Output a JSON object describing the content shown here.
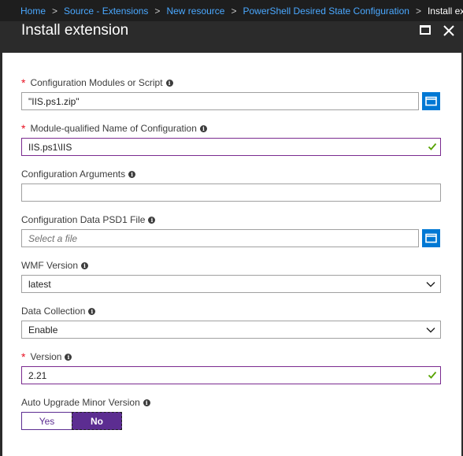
{
  "breadcrumb": {
    "items": [
      "Home",
      "Source - Extensions",
      "New resource",
      "PowerShell Desired State Configuration"
    ],
    "current": "Install extension",
    "separator": ">"
  },
  "header": {
    "title": "Install extension"
  },
  "fields": {
    "config_modules": {
      "label": "Configuration Modules or Script",
      "required": true,
      "value": "\"IIS.ps1.zip\""
    },
    "module_name": {
      "label": "Module-qualified Name of Configuration",
      "required": true,
      "value": "IIS.ps1\\IIS"
    },
    "config_args": {
      "label": "Configuration Arguments",
      "value": ""
    },
    "config_data": {
      "label": "Configuration Data PSD1 File",
      "placeholder": "Select a file"
    },
    "wmf_version": {
      "label": "WMF Version",
      "selected": "latest"
    },
    "data_collection": {
      "label": "Data Collection",
      "selected": "Enable"
    },
    "version": {
      "label": "Version",
      "required": true,
      "value": "2.21"
    },
    "auto_upgrade": {
      "label": "Auto Upgrade Minor Version",
      "options": [
        "Yes",
        "No"
      ],
      "selected": "No"
    }
  },
  "icons": {
    "info": "info-icon",
    "check": "checkmark-icon",
    "browse": "folder-icon",
    "chevron": "chevron-down-icon",
    "maximize": "maximize-icon",
    "close": "close-icon"
  },
  "colors": {
    "accent_purple": "#5c2d91",
    "valid_border": "#7a2a8f",
    "check_green": "#57a300",
    "browse_blue": "#0078d4",
    "link_blue": "#4aa8ff",
    "required_red": "#e81123"
  }
}
